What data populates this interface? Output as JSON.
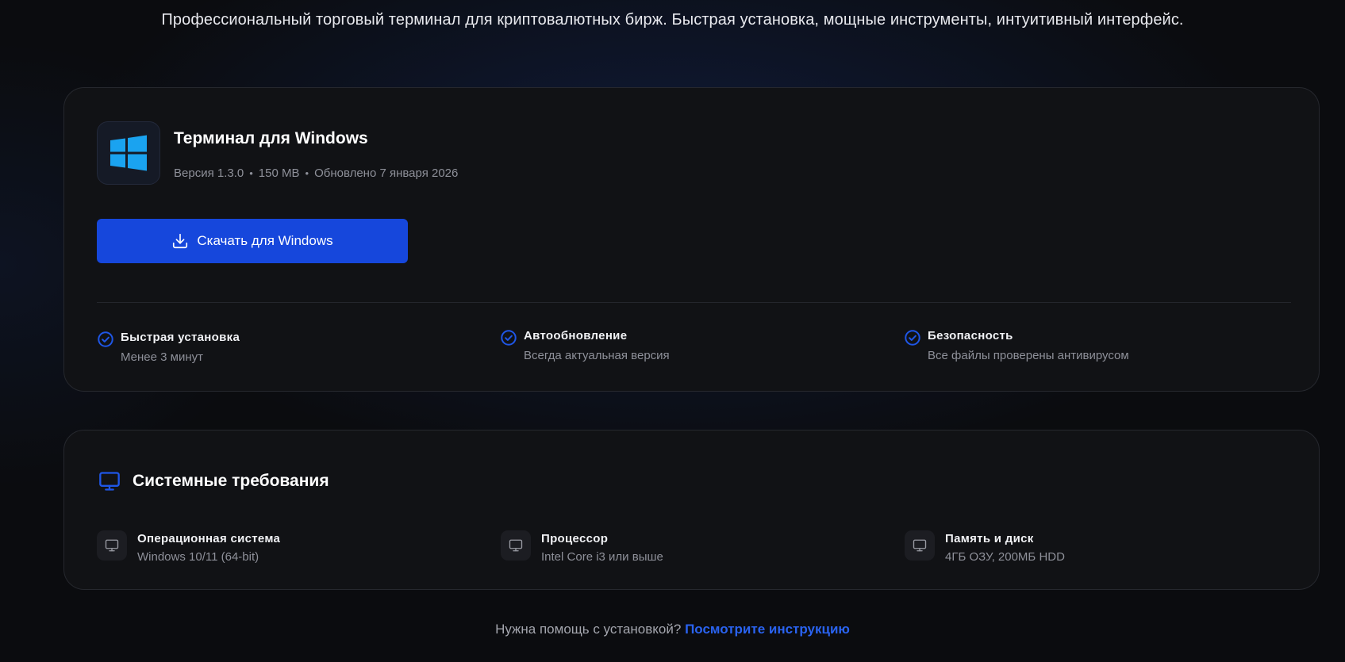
{
  "intro": "Профессиональный торговый терминал для криптовалютных бирж. Быстрая установка, мощные инструменты, интуитивный интерфейс.",
  "download_card": {
    "app_icon": "windows-logo-icon",
    "title": "Терминал для Windows",
    "version": "Версия 1.3.0",
    "size": "150 MB",
    "updated": "Обновлено 7 января 2026",
    "separator": "•",
    "button_label": "Скачать для Windows",
    "button_icon": "download-icon",
    "features": [
      {
        "icon": "check-circle-icon",
        "title": "Быстрая установка",
        "subtitle": "Менее 3 минут"
      },
      {
        "icon": "check-circle-icon",
        "title": "Автообновление",
        "subtitle": "Всегда актуальная версия"
      },
      {
        "icon": "check-circle-icon",
        "title": "Безопасность",
        "subtitle": "Все файлы проверены антивирусом"
      }
    ]
  },
  "requirements_card": {
    "icon": "monitor-icon",
    "title": "Системные требования",
    "items": [
      {
        "icon": "monitor-icon",
        "title": "Операционная система",
        "value": "Windows 10/11 (64-bit)"
      },
      {
        "icon": "monitor-icon",
        "title": "Процессор",
        "value": "Intel Core i3 или выше"
      },
      {
        "icon": "monitor-icon",
        "title": "Память и диск",
        "value": "4ГБ ОЗУ, 200МБ HDD"
      }
    ]
  },
  "help": {
    "text": "Нужна помощь с установкой?",
    "link": "Посмотрите инструкцию"
  },
  "colors": {
    "accent": "#1647dc",
    "link": "#2a63f0",
    "windows_logo": "#1aa3f0",
    "card_bg": "#111215",
    "page_bg": "#0b0c0f"
  }
}
